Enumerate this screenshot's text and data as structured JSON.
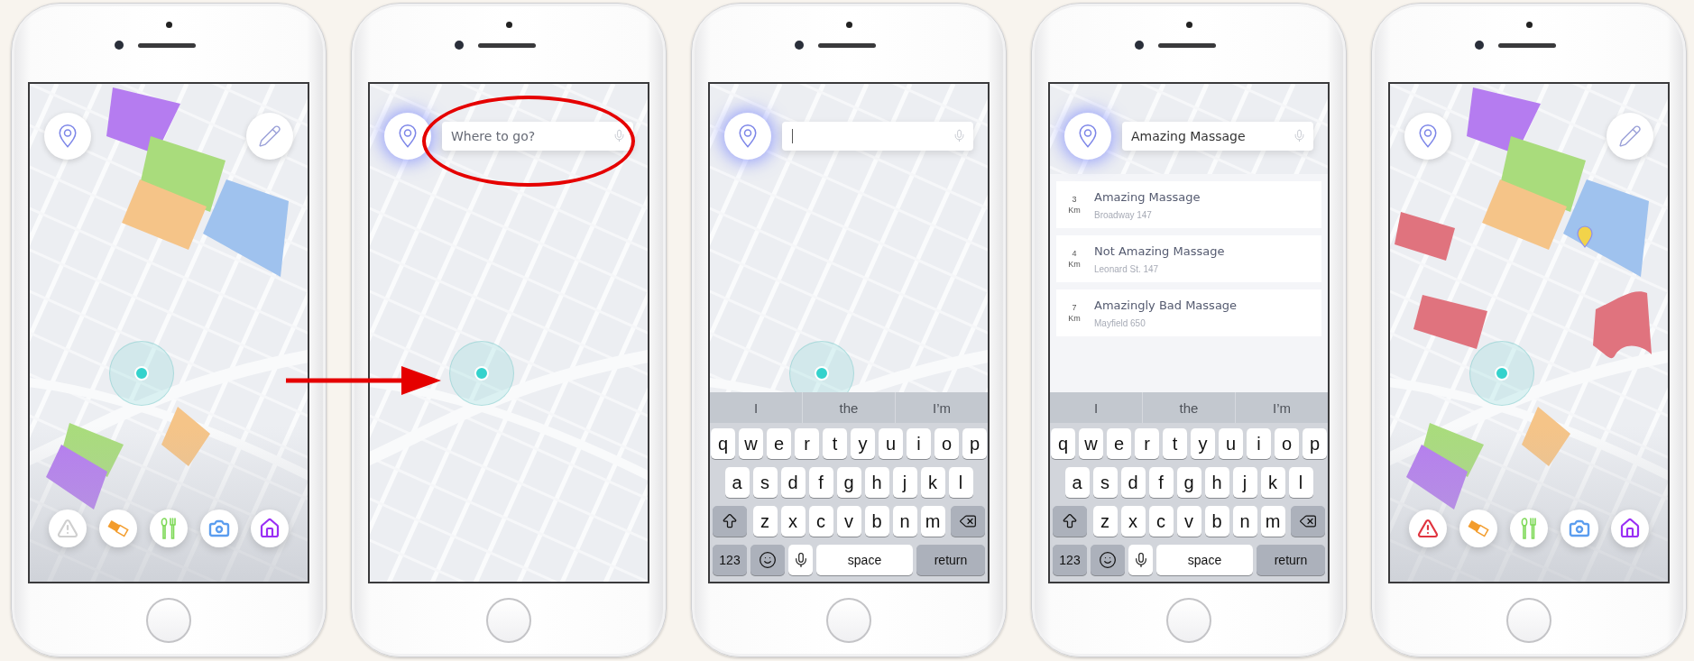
{
  "phones": [
    {
      "map": {
        "zones": true,
        "alert_zones": false,
        "place_marker": false
      },
      "location_dot": true,
      "pin_button": {
        "glow": false
      },
      "pencil_button": true,
      "categories": [
        {
          "kind": "warning",
          "color": "#cfcfcf"
        },
        {
          "kind": "tag",
          "color": "#f39c2c"
        },
        {
          "kind": "food",
          "color": "#7ed957"
        },
        {
          "kind": "camera",
          "color": "#5b9def"
        },
        {
          "kind": "home",
          "color": "#9a2ff5"
        }
      ]
    },
    {
      "arrow_before": true,
      "location_dot": true,
      "pin_button": {
        "glow": true
      },
      "search": {
        "placeholder": "Where to go?",
        "circled": true
      }
    },
    {
      "location_dot": true,
      "pin_button": {
        "glow": true
      },
      "search": {
        "focused": true
      },
      "keyboard": {
        "suggestions": [
          "I",
          "the",
          "I’m"
        ],
        "letter_rows": [
          [
            "q",
            "w",
            "e",
            "r",
            "t",
            "y",
            "u",
            "i",
            "o",
            "p"
          ],
          [
            "a",
            "s",
            "d",
            "f",
            "g",
            "h",
            "j",
            "k",
            "l"
          ],
          [
            "z",
            "x",
            "c",
            "v",
            "b",
            "n",
            "m"
          ]
        ],
        "number_key": "123",
        "space_key": "space",
        "return_key": "return"
      }
    },
    {
      "location_dot": false,
      "pin_button": {
        "glow": true
      },
      "search": {
        "value": "Amazing Massage"
      },
      "results": [
        {
          "distance": "3",
          "unit": "Km",
          "name": "Amazing Massage",
          "address": "Broadway 147"
        },
        {
          "distance": "4",
          "unit": "Km",
          "name": "Not Amazing Massage",
          "address": "Leonard St. 147"
        },
        {
          "distance": "7",
          "unit": "Km",
          "name": "Amazingly Bad Massage",
          "address": "Mayfield 650"
        }
      ],
      "keyboard": {
        "suggestions": [
          "I",
          "the",
          "I’m"
        ],
        "letter_rows": [
          [
            "q",
            "w",
            "e",
            "r",
            "t",
            "y",
            "u",
            "i",
            "o",
            "p"
          ],
          [
            "a",
            "s",
            "d",
            "f",
            "g",
            "h",
            "j",
            "k",
            "l"
          ],
          [
            "z",
            "x",
            "c",
            "v",
            "b",
            "n",
            "m"
          ]
        ],
        "number_key": "123",
        "space_key": "space",
        "return_key": "return"
      }
    },
    {
      "map": {
        "zones": true,
        "alert_zones": true,
        "place_marker": true
      },
      "location_dot": true,
      "pin_button": {
        "glow": false
      },
      "pencil_button": true,
      "categories": [
        {
          "kind": "warning",
          "color": "#e0343f"
        },
        {
          "kind": "tag",
          "color": "#f39c2c"
        },
        {
          "kind": "food",
          "color": "#7ed957"
        },
        {
          "kind": "camera",
          "color": "#5b9def"
        },
        {
          "kind": "home",
          "color": "#9a2ff5"
        }
      ]
    }
  ]
}
